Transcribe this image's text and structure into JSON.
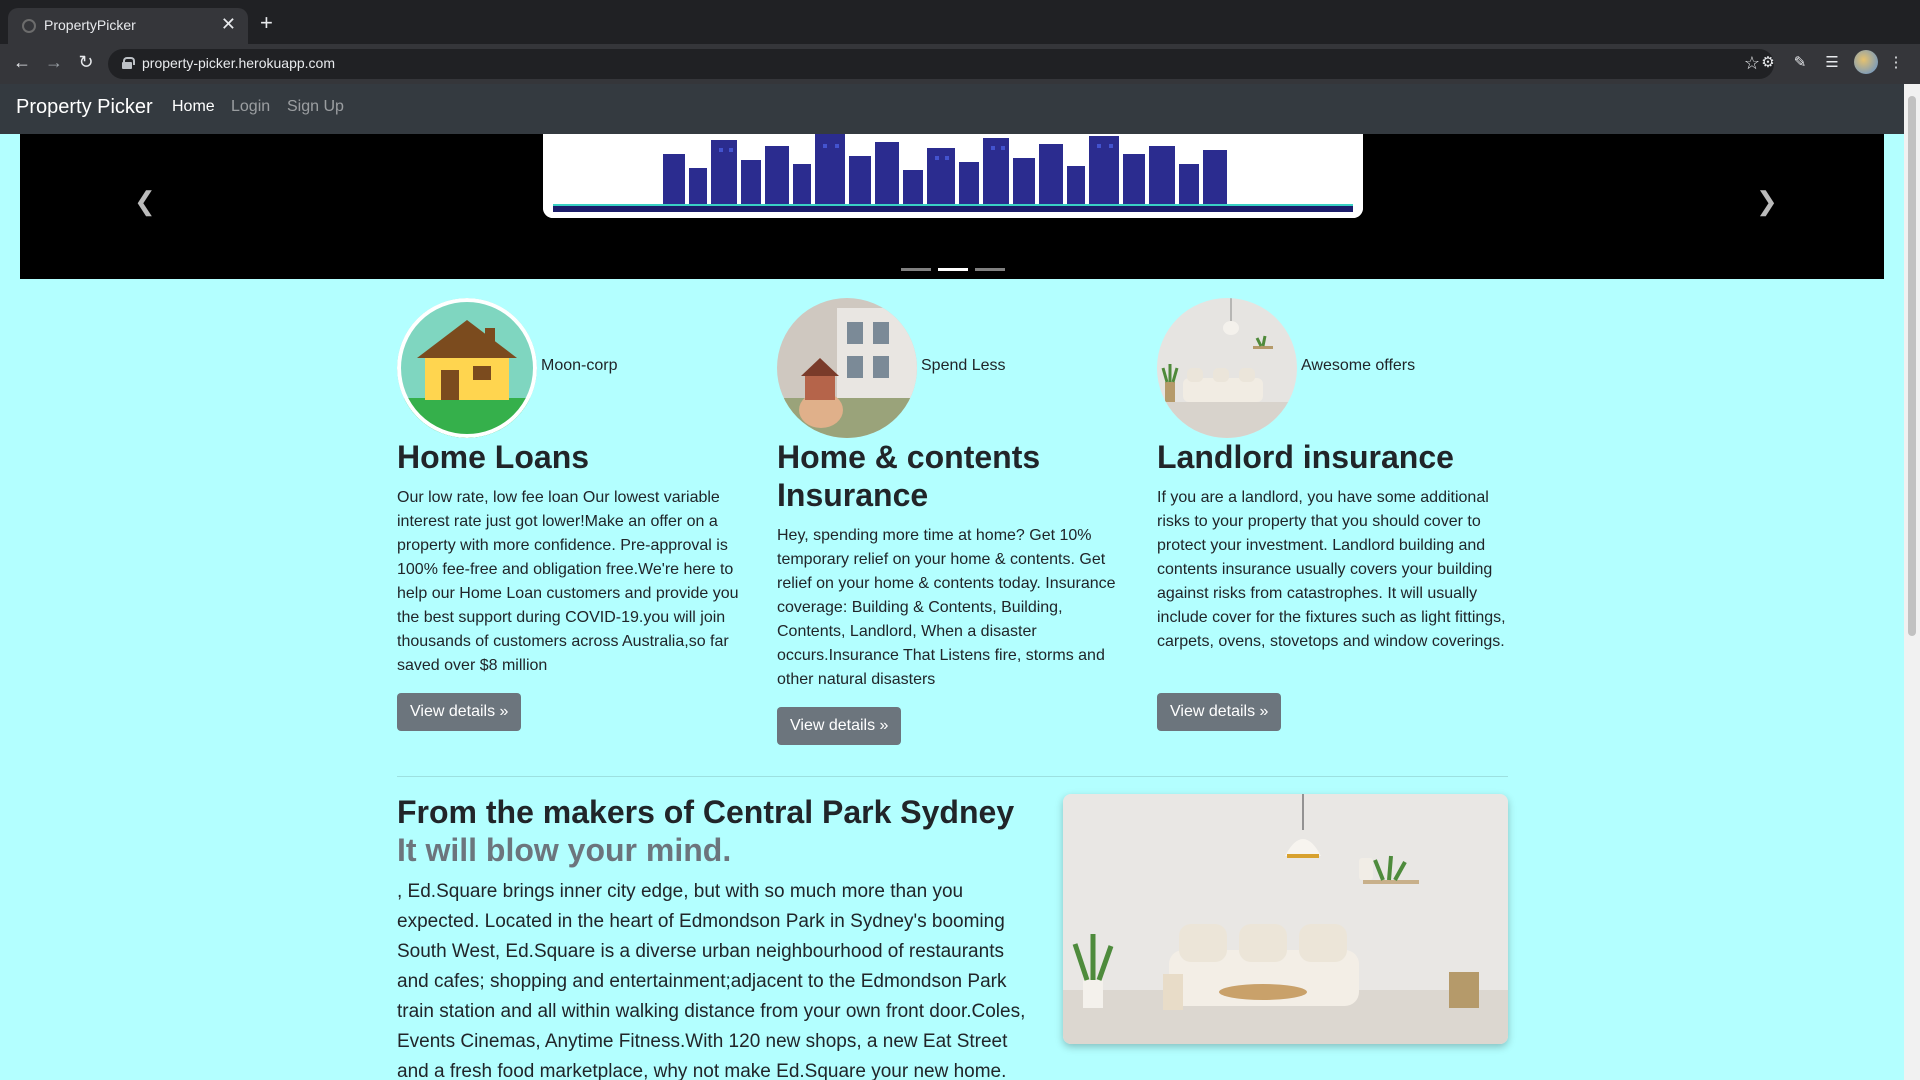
{
  "browser": {
    "tab_title": "PropertyPicker",
    "tab_close": "✕",
    "new_tab": "+",
    "url": "property-picker.herokuapp.com"
  },
  "navbar": {
    "brand": "Property Picker",
    "links": [
      {
        "label": "Home",
        "active": true
      },
      {
        "label": "Login",
        "active": false
      },
      {
        "label": "Sign Up",
        "active": false
      }
    ]
  },
  "carousel": {
    "prev_icon": "chevron-left-icon",
    "next_icon": "chevron-right-icon",
    "indicator_count": 3,
    "active_indicator": 1
  },
  "features": [
    {
      "caption": "Moon-corp",
      "heading": "Home Loans",
      "body": "Our low rate, low fee loan Our lowest variable interest rate just got lower!Make an offer on a property with more confidence. Pre-approval is 100% fee-free and obligation free.We're here to help our Home Loan customers and provide you the best support during COVID-19.you will join thousands of customers across Australia,so far saved over $8 million",
      "button": "View details »"
    },
    {
      "caption": "Spend Less",
      "heading": "Home & contents Insurance",
      "body": "Hey, spending more time at home? Get 10% temporary relief on your home & contents. Get relief on your home & contents today. Insurance coverage: Building & Contents, Building, Contents, Landlord, When a disaster occurs.Insurance That Listens fire, storms and other natural disasters",
      "button": "View details »"
    },
    {
      "caption": "Awesome offers",
      "heading": "Landlord insurance",
      "body": "If you are a landlord, you have some additional risks to your property that you should cover to protect your investment. Landlord building and contents insurance usually covers your building against risks from catastrophes. It will usually include cover for the fixtures such as light fittings, carpets, ovens, stovetops and window coverings.",
      "button": "View details »"
    }
  ],
  "featurette": {
    "heading": "From the makers of Central Park Sydney",
    "heading_muted": "It will blow your mind.",
    "body": ", Ed.Square brings inner city edge, but with so much more than you expected. Located in the heart of Edmondson Park in Sydney's booming South West, Ed.Square is a diverse urban neighbourhood of restaurants and cafes; shopping and entertainment;adjacent to the Edmondson Park train station and all within walking distance from your own front door.Coles, Events Cinemas, Anytime Fitness.With 120 new shops, a new Eat Street and a fresh food marketplace, why not make Ed.Square your new home."
  },
  "colors": {
    "page_bg": "#b3ffff",
    "navbar_bg": "#343a40",
    "button_bg": "#6c757d"
  }
}
